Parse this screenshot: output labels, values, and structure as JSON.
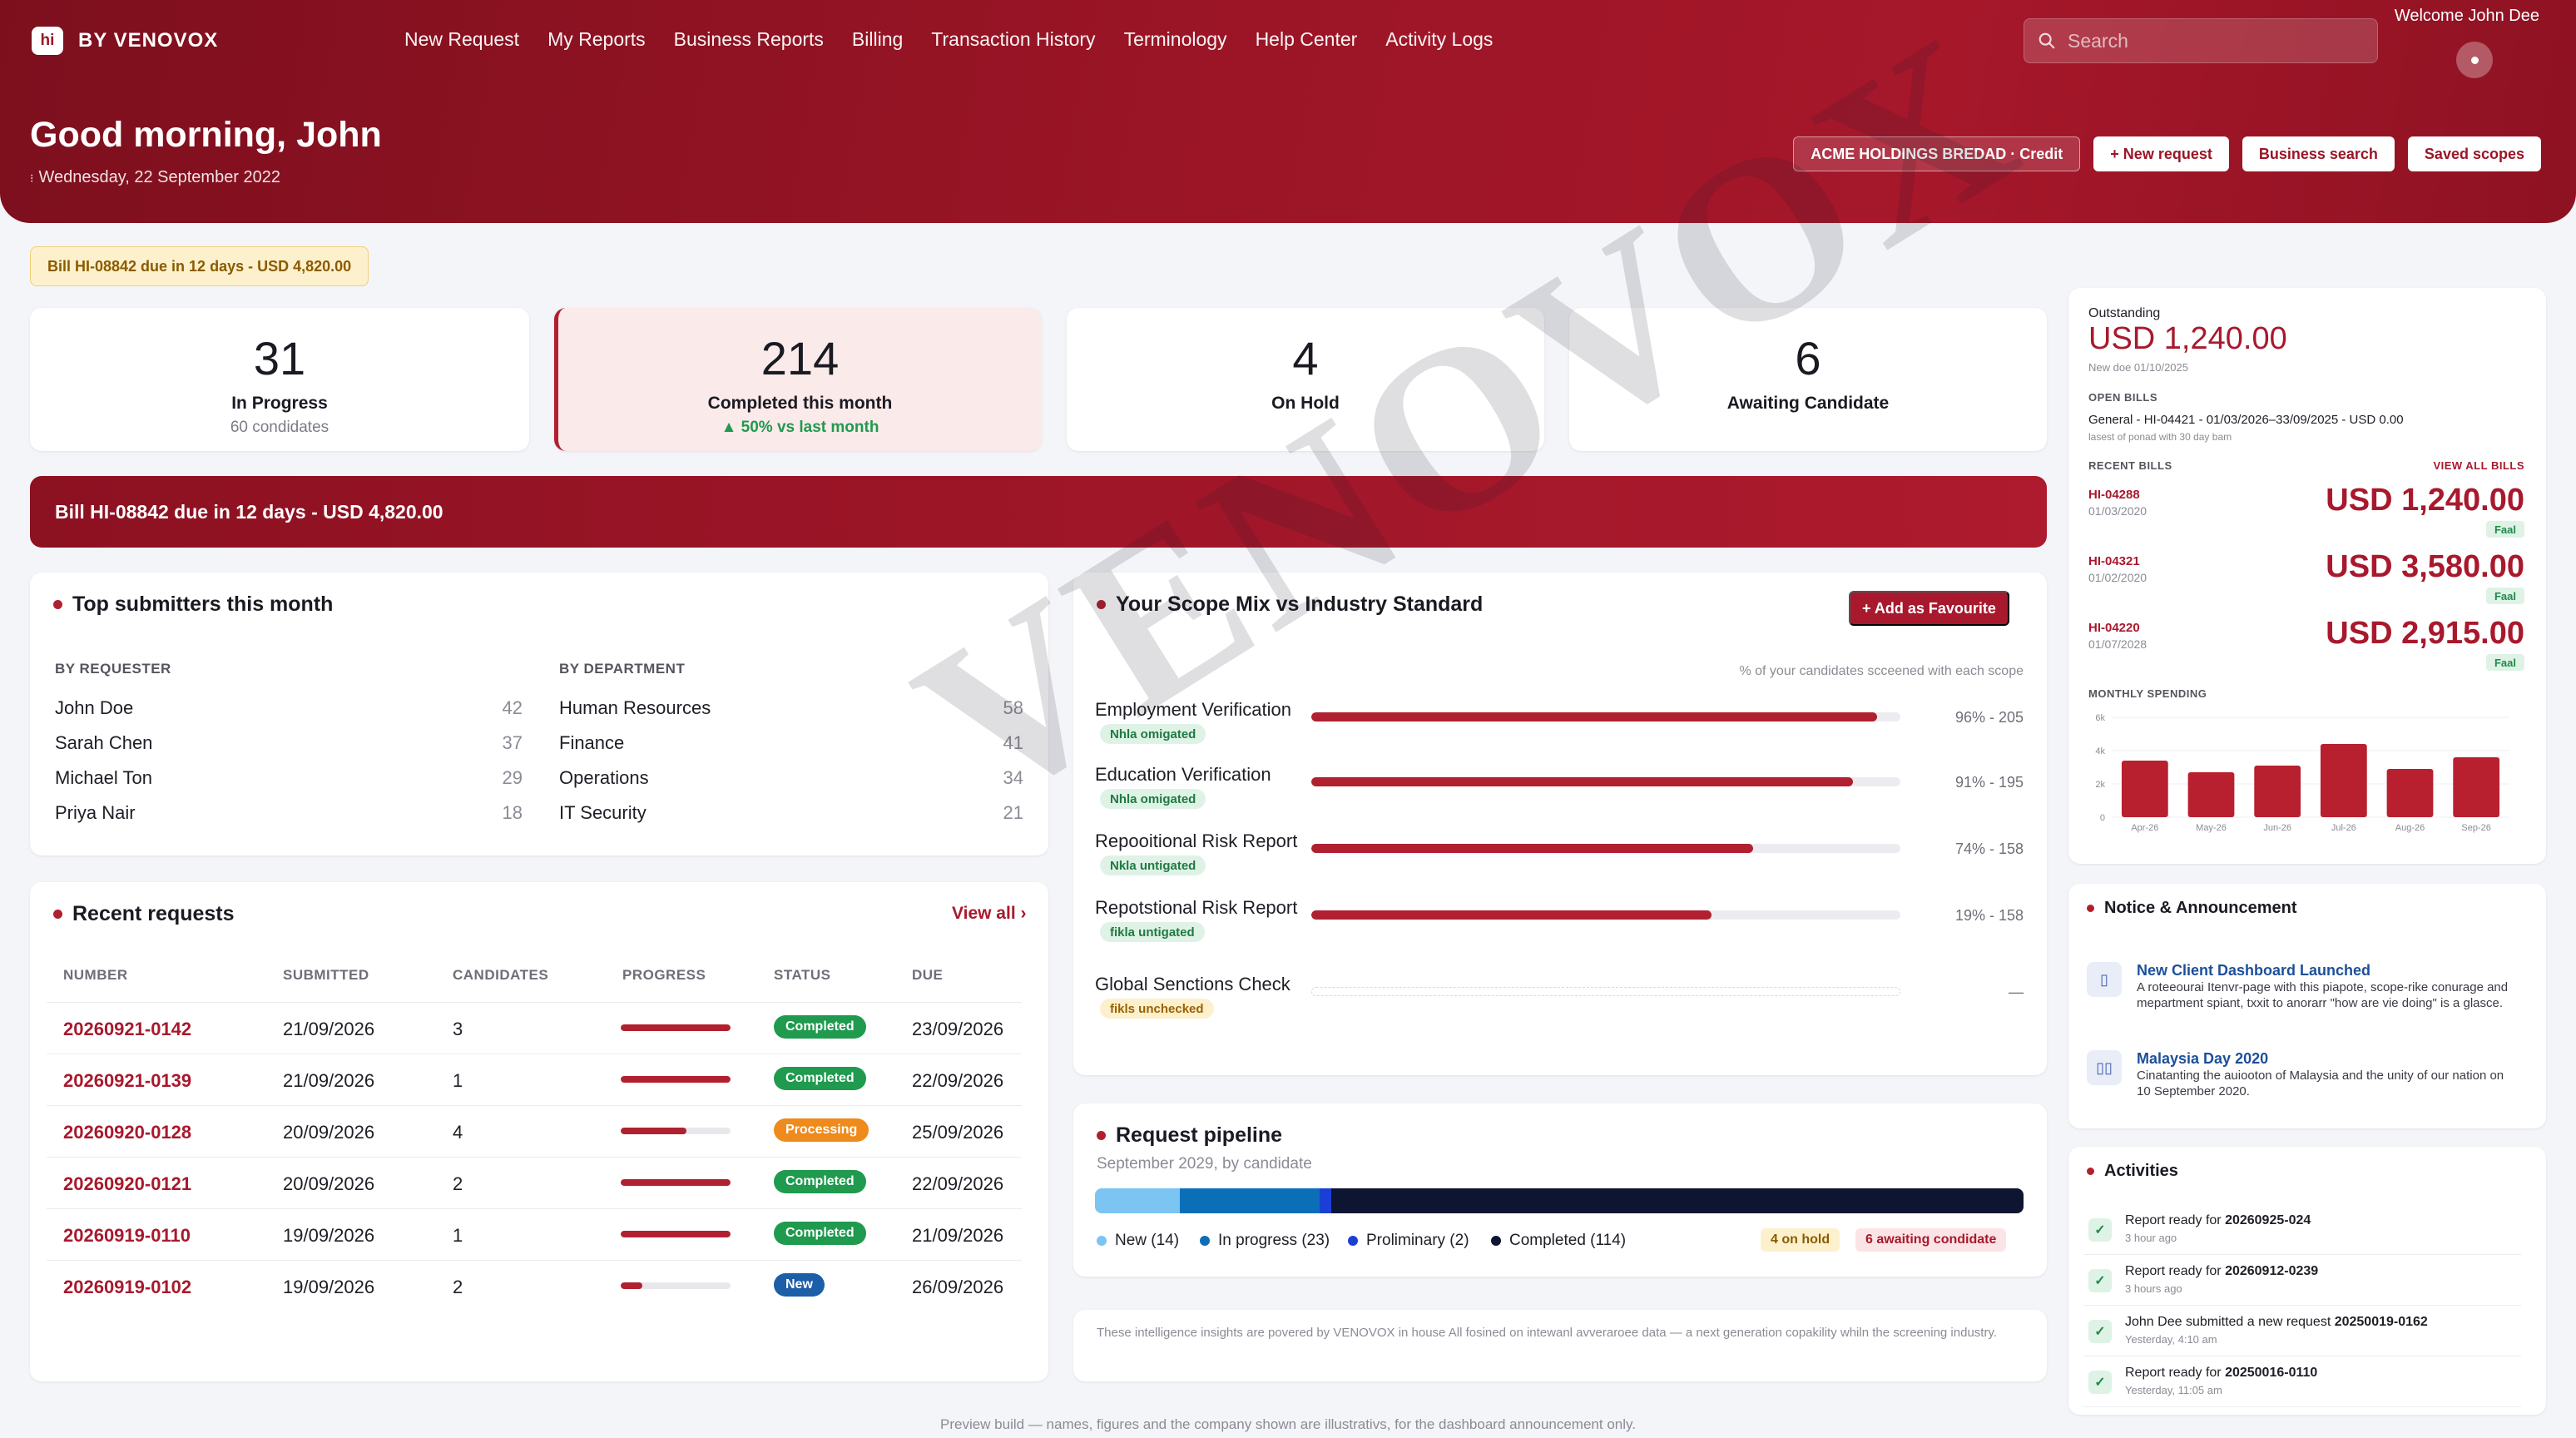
{
  "header": {
    "logo_badge": "hi",
    "brand": "BY VENOVOX",
    "nav": [
      "New Request",
      "My Reports",
      "Business Reports",
      "Billing",
      "Transaction History",
      "Terminology",
      "Help Center",
      "Activity Logs"
    ],
    "search_placeholder": "Search",
    "welcome": "Welcome John Dee",
    "greeting": "Good morning, John",
    "date": "Wednesday, 22 September 2022",
    "account_button": "ACME HOLDINGS BREDAD · Credit",
    "new_request_button": "+ New request",
    "business_search_button": "Business search",
    "saved_scopes_button": "Saved scopes"
  },
  "bill_pill": "Bill HI-08842 due in 12 days - USD 4,820.00",
  "stats": [
    {
      "num": "31",
      "label": "In Progress",
      "sub": "60 condidates"
    },
    {
      "num": "214",
      "label": "Completed this month",
      "sub": "▲ 50% vs last month"
    },
    {
      "num": "4",
      "label": "On Hold",
      "sub": ""
    },
    {
      "num": "6",
      "label": "Awaiting Candidate",
      "sub": ""
    }
  ],
  "banner": "Bill HI-08842 due in 12 days - USD 4,820.00",
  "submitters": {
    "title": "Top submitters this month",
    "by_requester_label": "BY REQUESTER",
    "by_department_label": "BY DEPARTMENT",
    "requesters": [
      {
        "name": "John Doe",
        "count": "42"
      },
      {
        "name": "Sarah Chen",
        "count": "37"
      },
      {
        "name": "Michael Ton",
        "count": "29"
      },
      {
        "name": "Priya Nair",
        "count": "18"
      }
    ],
    "departments": [
      {
        "name": "Human Resources",
        "count": "58"
      },
      {
        "name": "Finance",
        "count": "41"
      },
      {
        "name": "Operations",
        "count": "34"
      },
      {
        "name": "IT Security",
        "count": "21"
      }
    ]
  },
  "recent": {
    "title": "Recent requests",
    "view_all": "View all ›",
    "columns": [
      "NUMBER",
      "SUBMITTED",
      "CANDIDATES",
      "PROGRESS",
      "STATUS",
      "DUE"
    ],
    "rows": [
      {
        "number": "20260921-0142",
        "submitted": "21/09/2026",
        "candidates": "3",
        "progress": 100,
        "status": "Completed",
        "due": "23/09/2026"
      },
      {
        "number": "20260921-0139",
        "submitted": "21/09/2026",
        "candidates": "1",
        "progress": 100,
        "status": "Completed",
        "due": "22/09/2026"
      },
      {
        "number": "20260920-0128",
        "submitted": "20/09/2026",
        "candidates": "4",
        "progress": 60,
        "status": "Processing",
        "due": "25/09/2026"
      },
      {
        "number": "20260920-0121",
        "submitted": "20/09/2026",
        "candidates": "2",
        "progress": 100,
        "status": "Completed",
        "due": "22/09/2026"
      },
      {
        "number": "20260919-0110",
        "submitted": "19/09/2026",
        "candidates": "1",
        "progress": 100,
        "status": "Completed",
        "due": "21/09/2026"
      },
      {
        "number": "20260919-0102",
        "submitted": "19/09/2026",
        "candidates": "2",
        "progress": 20,
        "status": "New",
        "due": "26/09/2026"
      }
    ]
  },
  "scope": {
    "title": "Your Scope Mix vs Industry Standard",
    "fav_button": "+ Add as Favourite",
    "note": "% of your candidates scceened with each scope",
    "rows": [
      {
        "name": "Employment Verification",
        "tag": "Nhla omigated",
        "tag_type": "green",
        "pct": 96,
        "value": "96% - 205"
      },
      {
        "name": "Education Verification",
        "tag": "Nhla omigated",
        "tag_type": "green",
        "pct": 92,
        "value": "91% - 195"
      },
      {
        "name": "Repooitional Risk Report",
        "tag": "Nkla untigated",
        "tag_type": "green",
        "pct": 75,
        "value": "74% - 158"
      },
      {
        "name": "Repotstional Risk Report",
        "tag": "fikla untigated",
        "tag_type": "green",
        "pct": 68,
        "value": "19% - 158"
      },
      {
        "name": "Global Senctions Check",
        "tag": "fikls unchecked",
        "tag_type": "amber",
        "pct": 0,
        "value": "—"
      }
    ]
  },
  "pipeline": {
    "title": "Request pipeline",
    "subtitle": "September 2029, by candidate",
    "segments": [
      {
        "label": "New (14)",
        "value": 14,
        "color": "#7cc4f2"
      },
      {
        "label": "In progress (23)",
        "value": 23,
        "color": "#0b6fb8"
      },
      {
        "label": "Proliminary (2)",
        "value": 2,
        "color": "#1b3fd6"
      },
      {
        "label": "Completed (114)",
        "value": 114,
        "color": "#0e1533"
      }
    ],
    "on_hold": "4 on hold",
    "awaiting": "6 awaiting condidate"
  },
  "insight": "These intelligence insights are povered by VENOVOX in house All fosined on intewanl avveraroee data — a next generation copakility whiln the screening industry.",
  "footer": "Preview build — names, figures and the company shown are illustrativs, for the dashboard announcement only.",
  "billing": {
    "outstanding_label": "Outstanding",
    "outstanding_amount": "USD 1,240.00",
    "new_doe": "New doe 01/10/2025",
    "open_bills_label": "OPEN BILLS",
    "open_bill_line": "General - HI-04421 - 01/03/2026–33/09/2025 - USD 0.00",
    "open_bill_sub": "lasest of ponad with 30 day bam",
    "recent_label": "RECENT BILLS",
    "view_all": "VIEW ALL BILLS",
    "bills": [
      {
        "id": "HI-04288",
        "date": "01/03/2020",
        "amount": "USD 1,240.00",
        "status": "Faal"
      },
      {
        "id": "HI-04321",
        "date": "01/02/2020",
        "amount": "USD 3,580.00",
        "status": "Faal"
      },
      {
        "id": "HI-04220",
        "date": "01/07/2028",
        "amount": "USD 2,915.00",
        "status": "Faal"
      }
    ],
    "monthly_label": "MONTHLY SPENDING"
  },
  "chart_data": {
    "type": "bar",
    "categories": [
      "Apr-26",
      "May-26",
      "Jun-26",
      "Jul-26",
      "Aug-26",
      "Sep-26"
    ],
    "values": [
      3400,
      2700,
      3100,
      4400,
      2900,
      3600
    ],
    "yticks": [
      "6k",
      "4k",
      "2k",
      "0"
    ],
    "ylim": [
      0,
      6000
    ],
    "color": "#b8202f"
  },
  "notices": {
    "title": "Notice & Announcement",
    "items": [
      {
        "title": "New Client Dashboard Launched",
        "desc": "A roteeourai Itenvr-page with this piapote, scope-rike conurage and mepartment spiant, txxit to anorarr \"how are vie doing\" is a glasce."
      },
      {
        "title": "Malaysia Day 2020",
        "desc": "Cinatanting the auiooton of Malaysia and the unity of our nation on 10 September 2020."
      }
    ]
  },
  "activities": {
    "title": "Activities",
    "items": [
      {
        "text": "Report ready for ",
        "bold": "20260925-024",
        "time": "3 hour ago"
      },
      {
        "text": "Report ready for ",
        "bold": "20260912-0239",
        "time": "3 hours ago"
      },
      {
        "text": "John Dee submitted a new request ",
        "bold": "20250019-0162",
        "time": "Yesterday, 4:10 am"
      },
      {
        "text": "Report ready for ",
        "bold": "20250016-0110",
        "time": "Yesterday, 11:05 am"
      }
    ]
  },
  "watermark": "VENOVOX"
}
